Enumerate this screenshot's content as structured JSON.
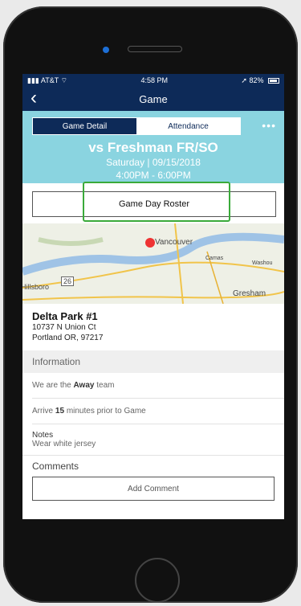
{
  "status": {
    "carrier": "AT&T",
    "time": "4:58 PM",
    "battery": "82%"
  },
  "nav": {
    "title": "Game"
  },
  "tabs": [
    {
      "label": "Game Detail"
    },
    {
      "label": "Attendance"
    }
  ],
  "event": {
    "opponent": "vs Freshman FR/SO",
    "date": "Saturday | 09/15/2018",
    "time": "4:00PM - 6:00PM"
  },
  "roster_button": "Game Day Roster",
  "map": {
    "labels": [
      "Vancouver",
      "Camas",
      "Washou",
      "Hillsboro",
      "26",
      "Gresham"
    ]
  },
  "location": {
    "name": "Delta Park #1",
    "street": "10737 N Union Ct",
    "city": "Portland  OR, 97217"
  },
  "information": {
    "header": "Information",
    "team_prefix": "We are the",
    "team_value": "Away",
    "team_suffix": "team",
    "arrive_prefix": "Arrive",
    "arrive_value": "15",
    "arrive_suffix": "minutes prior to Game",
    "notes_label": "Notes",
    "notes_value": "Wear white jersey"
  },
  "comments": {
    "header": "Comments",
    "add_button": "Add Comment"
  }
}
